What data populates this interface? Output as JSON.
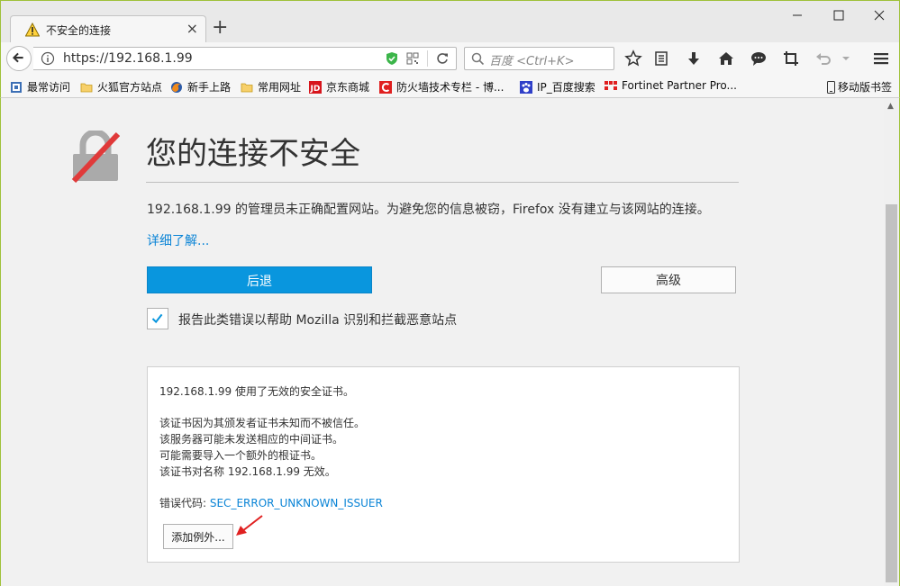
{
  "tab": {
    "title": "不安全的连接",
    "close": "×",
    "new_tab": "+"
  },
  "window": {
    "minimize": "minimize",
    "maximize": "maximize",
    "close": "close"
  },
  "navbar": {
    "url": "https://192.168.1.99",
    "search_placeholder": "百度 <Ctrl+K>"
  },
  "bookmarks": [
    {
      "label": "最常访问",
      "icon": "gear-bookmark-icon"
    },
    {
      "label": "火狐官方站点",
      "icon": "folder-icon"
    },
    {
      "label": "新手上路",
      "icon": "firefox-icon"
    },
    {
      "label": "常用网址",
      "icon": "folder-icon"
    },
    {
      "label": "京东商城",
      "icon": "jd-icon"
    },
    {
      "label": "防火墙技术专栏 - 博...",
      "icon": "site-icon"
    },
    {
      "label": "IP_百度搜索",
      "icon": "baidu-icon"
    },
    {
      "label": "Fortinet Partner Pro...",
      "icon": "fortinet-icon"
    }
  ],
  "mobile_bookmarks": "移动版书签",
  "page": {
    "headline": "您的连接不安全",
    "description": "192.168.1.99 的管理员未正确配置网站。为避免您的信息被窃，Firefox 没有建立与该网站的连接。",
    "learn_more": "详细了解...",
    "back_button": "后退",
    "advanced_button": "高级",
    "report_checked": true,
    "report_label": "报告此类错误以帮助 Mozilla 识别和拦截恶意站点"
  },
  "advanced": {
    "line1": "192.168.1.99 使用了无效的安全证书。",
    "reasons": [
      "该证书因为其颁发者证书未知而不被信任。",
      "该服务器可能未发送相应的中间证书。",
      "可能需要导入一个额外的根证书。",
      "该证书对名称 192.168.1.99 无效。"
    ],
    "error_code_label": "错误代码: ",
    "error_code": "SEC_ERROR_UNKNOWN_ISSUER",
    "add_exception_button": "添加例外..."
  },
  "colors": {
    "accent": "#0996de",
    "link": "#0a84d6",
    "arrow": "#e02020"
  }
}
